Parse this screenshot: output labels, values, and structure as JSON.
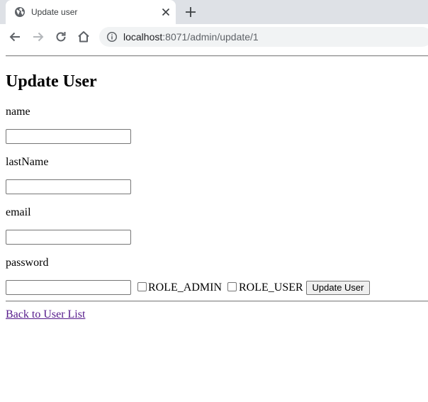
{
  "browser": {
    "tab_title": "Update user",
    "url_host": "localhost",
    "url_rest": ":8071/admin/update/1"
  },
  "icons": {
    "favicon": "globe-icon",
    "tab_close": "close-icon",
    "new_tab": "plus-icon",
    "back": "arrow-left-icon",
    "forward": "arrow-right-icon",
    "reload": "reload-icon",
    "home": "home-icon",
    "site_info": "info-icon"
  },
  "page": {
    "heading": "Update User",
    "form": {
      "name_label": "name",
      "name_value": "",
      "lastname_label": "lastName",
      "lastname_value": "",
      "email_label": "email",
      "email_value": "",
      "password_label": "password",
      "password_value": "",
      "role_admin_label": "ROLE_ADMIN",
      "role_admin_checked": false,
      "role_user_label": "ROLE_USER",
      "role_user_checked": false,
      "submit_label": "Update User"
    },
    "back_link": "Back to User List"
  },
  "colors": {
    "tabstrip": "#dee1e6",
    "omnibox": "#f1f3f4",
    "visited_link": "#551a8b"
  }
}
